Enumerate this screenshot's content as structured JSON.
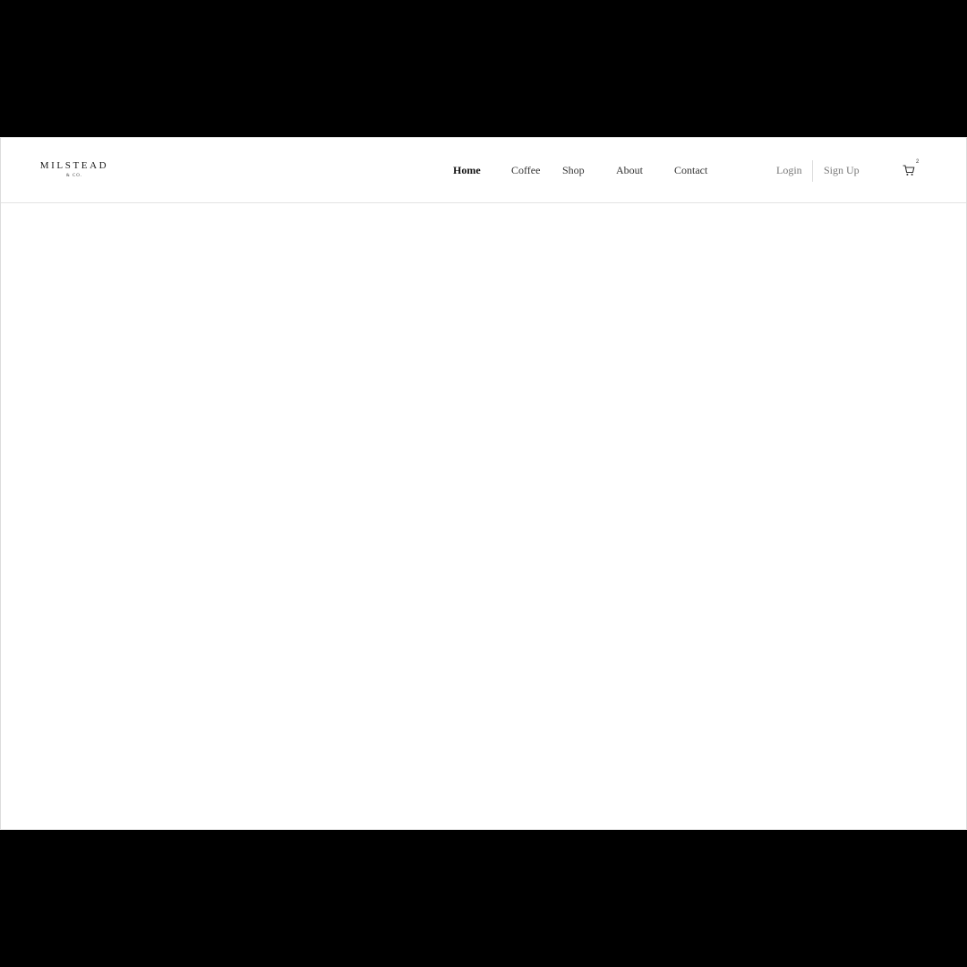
{
  "brand": {
    "name": "MILSTEAD",
    "tagline": "& CO."
  },
  "nav": {
    "items": [
      {
        "label": "Home",
        "active": true
      },
      {
        "label": "Coffee",
        "active": false
      },
      {
        "label": "Shop",
        "active": false
      },
      {
        "label": "About",
        "active": false
      },
      {
        "label": "Contact",
        "active": false
      }
    ]
  },
  "auth": {
    "login_label": "Login",
    "signup_label": "Sign Up"
  },
  "cart": {
    "icon": "cart-icon",
    "count": "2"
  },
  "colors": {
    "background": "#ffffff",
    "text": "#333333",
    "muted": "#777777",
    "divider": "#e3e3e3"
  }
}
